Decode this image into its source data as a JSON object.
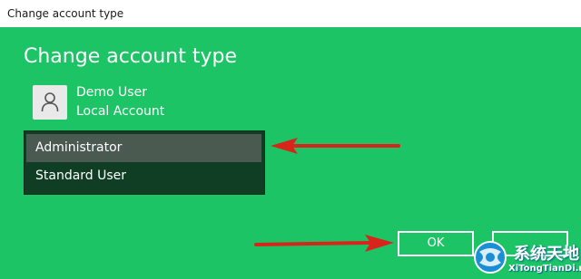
{
  "window": {
    "title": "Change account type"
  },
  "dialog": {
    "heading": "Change account type",
    "user": {
      "name": "Demo User",
      "account_type": "Local Account",
      "avatar_icon": "person-icon"
    },
    "options": [
      {
        "label": "Administrator",
        "selected": true
      },
      {
        "label": "Standard User",
        "selected": false
      }
    ],
    "buttons": {
      "ok": "OK",
      "cancel": ""
    }
  },
  "watermark": {
    "text_cn": "系统天地",
    "text_en": "XiTongTianDi.net"
  },
  "colors": {
    "dialog_bg": "#1cc466",
    "listbox_bg": "#103e24",
    "selected_bg": "#4b5a50",
    "arrow": "#d9241b"
  }
}
